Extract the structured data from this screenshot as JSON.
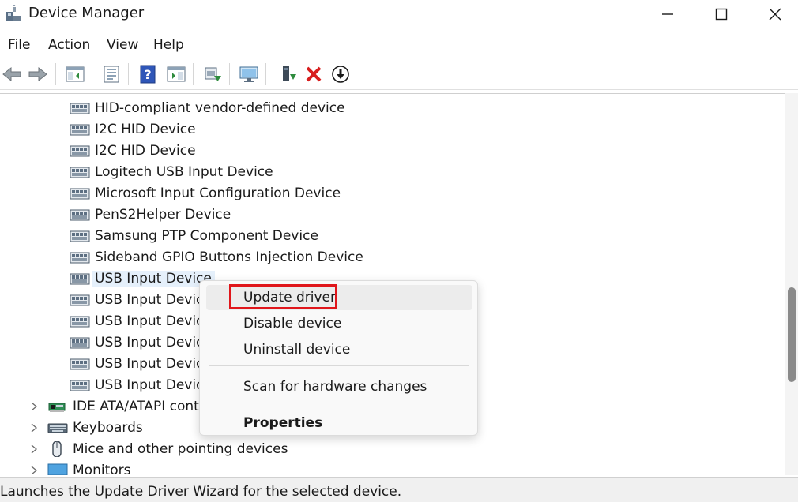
{
  "window": {
    "title": "Device Manager"
  },
  "menu": [
    "File",
    "Action",
    "View",
    "Help"
  ],
  "toolbar": {
    "icons": [
      "back-arrow-icon",
      "forward-arrow-icon",
      "show-hide-console-tree-icon",
      "properties-icon",
      "help-icon",
      "action-pane-icon",
      "update-driver-icon",
      "scan-hardware-icon",
      "add-legacy-hardware-icon",
      "uninstall-icon",
      "disable-device-icon"
    ]
  },
  "tree": {
    "hid_children": [
      "HID-compliant vendor-defined device",
      "I2C HID Device",
      "I2C HID Device",
      "Logitech USB Input Device",
      "Microsoft Input Configuration Device",
      "PenS2Helper Device",
      "Samsung PTP Component Device",
      "Sideband GPIO Buttons Injection Device",
      "USB Input Device",
      "USB Input Device",
      "USB Input Device",
      "USB Input Device",
      "USB Input Device",
      "USB Input Device"
    ],
    "categories": [
      "IDE ATA/ATAPI controllers",
      "Keyboards",
      "Mice and other pointing devices",
      "Monitors"
    ]
  },
  "context_menu": {
    "update_driver": "Update driver",
    "disable_device": "Disable device",
    "uninstall_device": "Uninstall device",
    "scan_hardware": "Scan for hardware changes",
    "properties": "Properties"
  },
  "status": {
    "text": "Launches the Update Driver Wizard for the selected device."
  },
  "colors": {
    "highlight": "#e0161b",
    "selection": "#e5f0fb"
  }
}
